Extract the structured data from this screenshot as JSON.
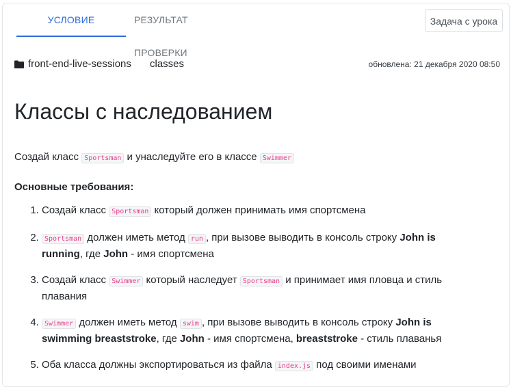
{
  "tabs": {
    "condition": "УСЛОВИЕ",
    "result": "РЕЗУЛЬТАТ ПРОВЕРКИ"
  },
  "task_button": "Задача с урока",
  "meta": {
    "folder": "front-end-live-sessions",
    "topic": "classes",
    "updated": "обновлена: 21 декабря 2020 08:50"
  },
  "title": "Классы с наследованием",
  "intro": {
    "t1": "Создай класс ",
    "c1": "Sportsman",
    "t2": " и унаследуйте его в классе ",
    "c2": "Swimmer"
  },
  "requirements_title": "Основные требования:",
  "items": [
    {
      "t1": "Создай класс ",
      "c1": "Sportsman",
      "t2": " который должен принимать имя спортсмена"
    },
    {
      "c1": "Sportsman",
      "t1": " должен иметь метод ",
      "c2": "run",
      "t2": ", при вызове выводить в консоль строку ",
      "b1": "John is running",
      "t3": ", где ",
      "b2": "John",
      "t4": " - имя спортсмена"
    },
    {
      "t1": "Создай класс ",
      "c1": "Swimmer",
      "t2": " который наследует ",
      "c2": "Sportsman",
      "t3": " и принимает имя пловца и стиль плавания"
    },
    {
      "c1": "Swimmer",
      "t1": " должен иметь метод ",
      "c2": "swim",
      "t2": ", при вызове выводить в консоль строку ",
      "b1": "John is swimming breaststroke",
      "t3": ", где ",
      "b2": "John",
      "t4": " - имя спортсмена, ",
      "b3": "breaststroke",
      "t5": " - стиль плаванья"
    },
    {
      "t1": "Оба класса должны экспортироваться из файла ",
      "c1": "index.js",
      "t2": " под своими именами"
    }
  ],
  "colors": {
    "accent": "#2d6cdf",
    "code": "#e83e8c",
    "text": "#212529"
  },
  "icons": {
    "folder": "folder-icon"
  }
}
